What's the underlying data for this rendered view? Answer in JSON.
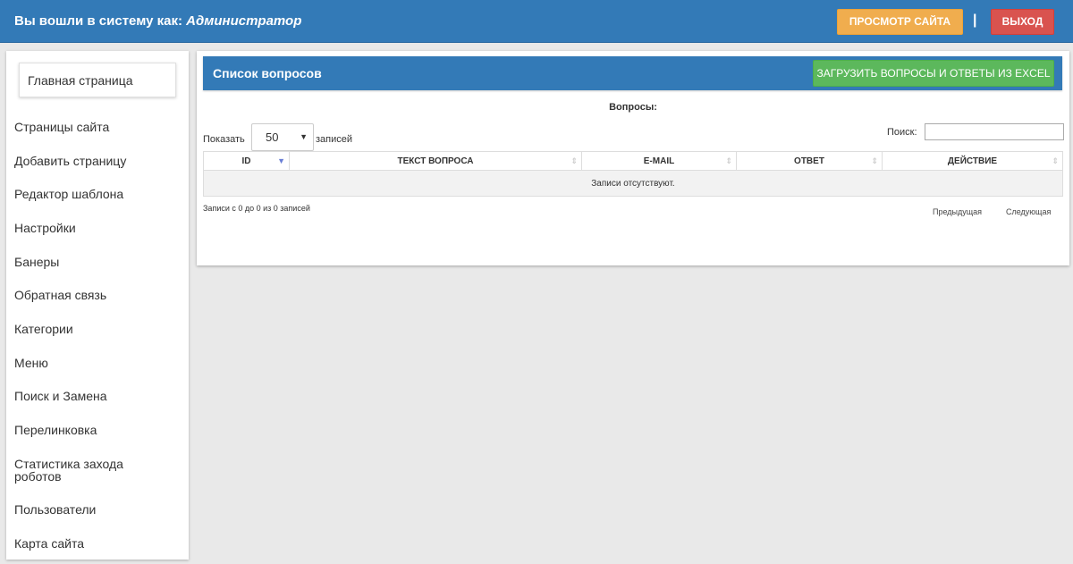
{
  "header": {
    "login_prefix": "Вы вошли в систему как:",
    "login_user": "Администратор",
    "view_site_label": "ПРОСМОТР САЙТА",
    "separator": "|",
    "logout_label": "ВЫХОД"
  },
  "sidebar": {
    "home_label": "Главная страница",
    "items": [
      {
        "label": "Страницы сайта"
      },
      {
        "label": "Добавить страницу"
      },
      {
        "label": "Редактор шаблона"
      },
      {
        "label": "Настройки"
      },
      {
        "label": "Банеры"
      },
      {
        "label": "Обратная связь"
      },
      {
        "label": "Категории"
      },
      {
        "label": "Меню"
      },
      {
        "label": "Поиск и Замена"
      },
      {
        "label": "Перелинковка"
      },
      {
        "label": "Статистика захода роботов"
      },
      {
        "label": "Пользователи"
      },
      {
        "label": "Карта сайта"
      }
    ]
  },
  "panel": {
    "title": "Список вопросов",
    "upload_label": "ЗАГРУЗИТЬ ВОПРОСЫ И ОТВЕТЫ ИЗ EXCEL",
    "questions_label": "Вопросы:",
    "show_label": "Показать",
    "page_size": "50",
    "entries_label": "записей",
    "search_label": "Поиск:",
    "search_value": ""
  },
  "table": {
    "columns": [
      {
        "label": "ID"
      },
      {
        "label": "ТЕКСТ ВОПРОСА"
      },
      {
        "label": "E-MAIL"
      },
      {
        "label": "ОТВЕТ"
      },
      {
        "label": "ДЕЙСТВИЕ"
      }
    ],
    "empty_text": "Записи отсутствуют.",
    "info_text": "Записи с 0 до 0 из 0 записей",
    "prev_label": "Предыдущая",
    "next_label": "Следующая"
  },
  "colors": {
    "primary": "#337ab7",
    "warning": "#f0ad4e",
    "danger": "#d9534f",
    "success": "#5cb85c",
    "sort_active": "#6a7fd6"
  },
  "icons": {
    "select_caret": "caret-down-icon",
    "sort_active": "sort-desc-icon",
    "sort_idle": "sort-both-icon"
  }
}
